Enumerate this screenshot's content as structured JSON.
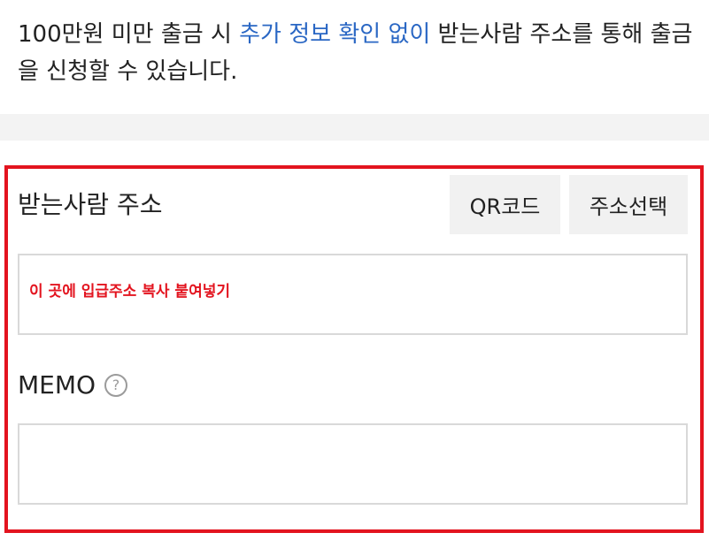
{
  "intro": {
    "prefix": "100만원 미만 출금 시 ",
    "highlight": "추가 정보 확인 없이",
    "suffix": " 받는사람 주소를 통해 출금을 신청할 수 있습니다."
  },
  "address": {
    "title": "받는사람 주소",
    "qr_button": "QR코드",
    "select_button": "주소선택",
    "paste_hint": "이 곳에 입급주소 복사 붙여넣기"
  },
  "memo": {
    "label": "MEMO",
    "help_glyph": "?"
  },
  "colors": {
    "highlight": "#2a67c4",
    "annotation_red": "#e3141f",
    "button_bg": "#f1f1f1"
  },
  "icons": [
    "help-circle-icon"
  ]
}
